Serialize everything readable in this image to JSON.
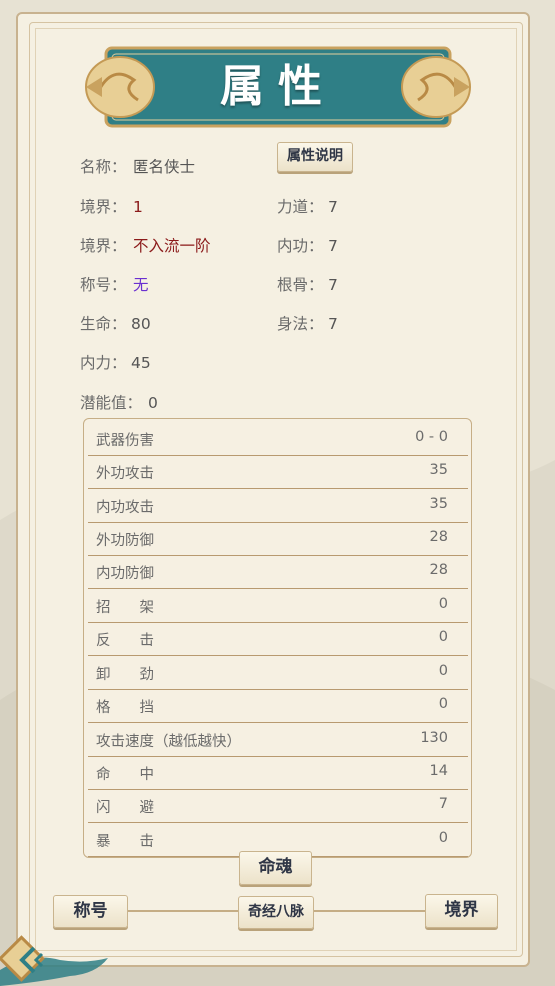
{
  "title": "属性",
  "explain_button": "属性说明",
  "info": {
    "name_label": "名称：",
    "name_value": "匿名侠士",
    "realm1_label": "境界：",
    "realm1_value": "1",
    "strength_label": "力道：",
    "strength_value": "7",
    "realm2_label": "境界：",
    "realm2_value": "不入流一阶",
    "internal_label": "内功：",
    "internal_value": "7",
    "title_label": "称号：",
    "title_value": "无",
    "bone_label": "根骨：",
    "bone_value": "7",
    "hp_label": "生命：",
    "hp_value": "80",
    "agility_label": "身法：",
    "agility_value": "7",
    "mp_label": "内力：",
    "mp_value": "45",
    "potential_label": "潜能值：",
    "potential_value": "0"
  },
  "stats": [
    {
      "name": "武器伤害",
      "value": "0 - 0"
    },
    {
      "name": "外功攻击",
      "value": "35"
    },
    {
      "name": "内功攻击",
      "value": "35"
    },
    {
      "name": "外功防御",
      "value": "28"
    },
    {
      "name": "内功防御",
      "value": "28"
    },
    {
      "name": "招　　架",
      "value": "0"
    },
    {
      "name": "反　　击",
      "value": "0"
    },
    {
      "name": "卸　　劲",
      "value": "0"
    },
    {
      "name": "格　　挡",
      "value": "0"
    },
    {
      "name": "攻击速度（越低越快）",
      "value": "130"
    },
    {
      "name": "命　　中",
      "value": "14"
    },
    {
      "name": "闪　　避",
      "value": "7"
    },
    {
      "name": "暴　　击",
      "value": "0"
    }
  ],
  "buttons": {
    "soul": "命魂",
    "title": "称号",
    "meridian": "奇经八脉",
    "realm": "境界"
  },
  "colors": {
    "banner": "#2f7f86",
    "gold": "#c9a25f",
    "realm_value": "#8b1a1a",
    "title_value": "#6a2fd0"
  },
  "icons": {
    "back": "back-arrow-icon"
  }
}
